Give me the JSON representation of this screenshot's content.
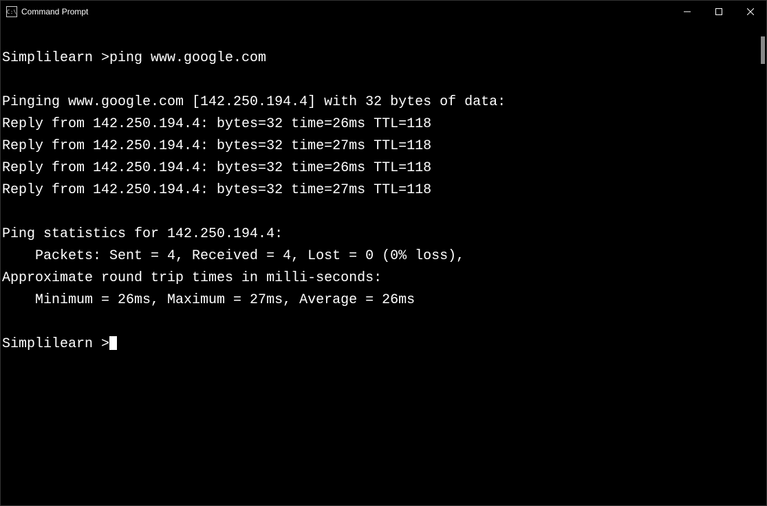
{
  "window": {
    "title": "Command Prompt",
    "icon_text": "C:\\"
  },
  "terminal": {
    "lines": [
      "",
      "Simplilearn >ping www.google.com",
      "",
      "Pinging www.google.com [142.250.194.4] with 32 bytes of data:",
      "Reply from 142.250.194.4: bytes=32 time=26ms TTL=118",
      "Reply from 142.250.194.4: bytes=32 time=27ms TTL=118",
      "Reply from 142.250.194.4: bytes=32 time=26ms TTL=118",
      "Reply from 142.250.194.4: bytes=32 time=27ms TTL=118",
      "",
      "Ping statistics for 142.250.194.4:",
      "    Packets: Sent = 4, Received = 4, Lost = 0 (0% loss),",
      "Approximate round trip times in milli-seconds:",
      "    Minimum = 26ms, Maximum = 27ms, Average = 26ms",
      ""
    ],
    "prompt": "Simplilearn >"
  }
}
